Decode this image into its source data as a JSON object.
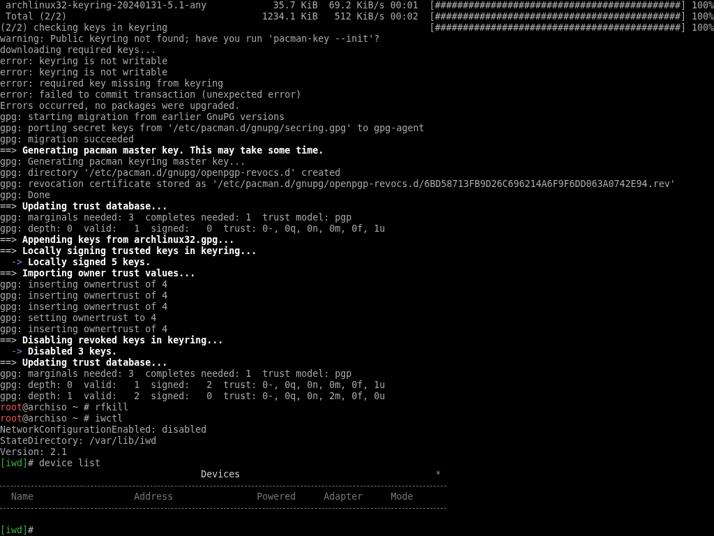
{
  "progress": [
    {
      "kind": "package",
      "label": "archlinux32-keyring-20240131-5.1-any",
      "size": "35.7 KiB",
      "rate": "69.2 KiB/s",
      "time": "00:01",
      "bar": "[############################################]",
      "percent": "100%"
    },
    {
      "kind": "total",
      "label": "Total (2/2)",
      "size": "1234.1 KiB",
      "rate": "512 KiB/s",
      "time": "00:02",
      "bar": "[############################################]",
      "percent": "100%"
    },
    {
      "kind": "check",
      "label": "(2/2) checking keys in keyring",
      "bar": "[############################################]",
      "percent": "100%"
    }
  ],
  "lines": [
    {
      "kind": "text",
      "text": "warning: Public keyring not found; have you run 'pacman-key --init'?"
    },
    {
      "kind": "text",
      "text": "downloading required keys..."
    },
    {
      "kind": "text",
      "text": "error: keyring is not writable"
    },
    {
      "kind": "text",
      "text": "error: keyring is not writable"
    },
    {
      "kind": "text",
      "text": "error: required key missing from keyring"
    },
    {
      "kind": "text",
      "text": "error: failed to commit transaction (unexpected error)"
    },
    {
      "kind": "text",
      "text": "Errors occurred, no packages were upgraded."
    },
    {
      "kind": "text",
      "text": "gpg: starting migration from earlier GnuPG versions"
    },
    {
      "kind": "text",
      "text": "gpg: porting secret keys from '/etc/pacman.d/gnupg/secring.gpg' to gpg-agent"
    },
    {
      "kind": "text",
      "text": "gpg: migration succeeded"
    },
    {
      "kind": "step",
      "marker": "==>",
      "text": "Generating pacman master key. This may take some time."
    },
    {
      "kind": "text",
      "text": "gpg: Generating pacman keyring master key..."
    },
    {
      "kind": "text",
      "text": "gpg: directory '/etc/pacman.d/gnupg/openpgp-revocs.d' created"
    },
    {
      "kind": "text",
      "text": "gpg: revocation certificate stored as '/etc/pacman.d/gnupg/openpgp-revocs.d/6BD58713FB9D26C696214A6F9F6DD063A0742E94.rev'"
    },
    {
      "kind": "text",
      "text": "gpg: Done"
    },
    {
      "kind": "step",
      "marker": "==>",
      "text": "Updating trust database..."
    },
    {
      "kind": "text",
      "text": "gpg: marginals needed: 3  completes needed: 1  trust model: pgp"
    },
    {
      "kind": "text",
      "text": "gpg: depth: 0  valid:   1  signed:   0  trust: 0-, 0q, 0n, 0m, 0f, 1u"
    },
    {
      "kind": "step",
      "marker": "==>",
      "text": "Appending keys from archlinux32.gpg..."
    },
    {
      "kind": "step",
      "marker": "==>",
      "text": "Locally signing trusted keys in keyring..."
    },
    {
      "kind": "substep",
      "marker": "->",
      "text": "Locally signed 5 keys."
    },
    {
      "kind": "step",
      "marker": "==>",
      "text": "Importing owner trust values..."
    },
    {
      "kind": "text",
      "text": "gpg: inserting ownertrust of 4"
    },
    {
      "kind": "text",
      "text": "gpg: inserting ownertrust of 4"
    },
    {
      "kind": "text",
      "text": "gpg: inserting ownertrust of 4"
    },
    {
      "kind": "text",
      "text": "gpg: setting ownertrust to 4"
    },
    {
      "kind": "text",
      "text": "gpg: inserting ownertrust of 4"
    },
    {
      "kind": "step",
      "marker": "==>",
      "text": "Disabling revoked keys in keyring..."
    },
    {
      "kind": "substep",
      "marker": "->",
      "text": "Disabled 3 keys."
    },
    {
      "kind": "step",
      "marker": "==>",
      "text": "Updating trust database..."
    },
    {
      "kind": "text",
      "text": "gpg: marginals needed: 3  completes needed: 1  trust model: pgp"
    },
    {
      "kind": "text",
      "text": "gpg: depth: 0  valid:   1  signed:   2  trust: 0-, 0q, 0n, 0m, 0f, 1u"
    },
    {
      "kind": "text",
      "text": "gpg: depth: 1  valid:   2  signed:   0  trust: 0-, 0q, 0n, 2m, 0f, 0u"
    },
    {
      "kind": "shell",
      "user": "root",
      "host": "@archiso ~ #",
      "command": "rfkill"
    },
    {
      "kind": "shell",
      "user": "root",
      "host": "@archiso ~ #",
      "command": "iwctl"
    },
    {
      "kind": "text",
      "text": "NetworkConfigurationEnabled: disabled"
    },
    {
      "kind": "text",
      "text": "StateDirectory: /var/lib/iwd"
    },
    {
      "kind": "text",
      "text": "Version: 2.1"
    },
    {
      "kind": "iwd",
      "prompt": "[iwd]",
      "symbol": "#",
      "command": "device list"
    }
  ],
  "devices_table": {
    "title": "Devices",
    "marker": "*",
    "columns": [
      "Name",
      "Address",
      "Powered",
      "Adapter",
      "Mode"
    ]
  },
  "final_prompt": {
    "kind": "iwd",
    "prompt": "[iwd]",
    "symbol": "#"
  }
}
